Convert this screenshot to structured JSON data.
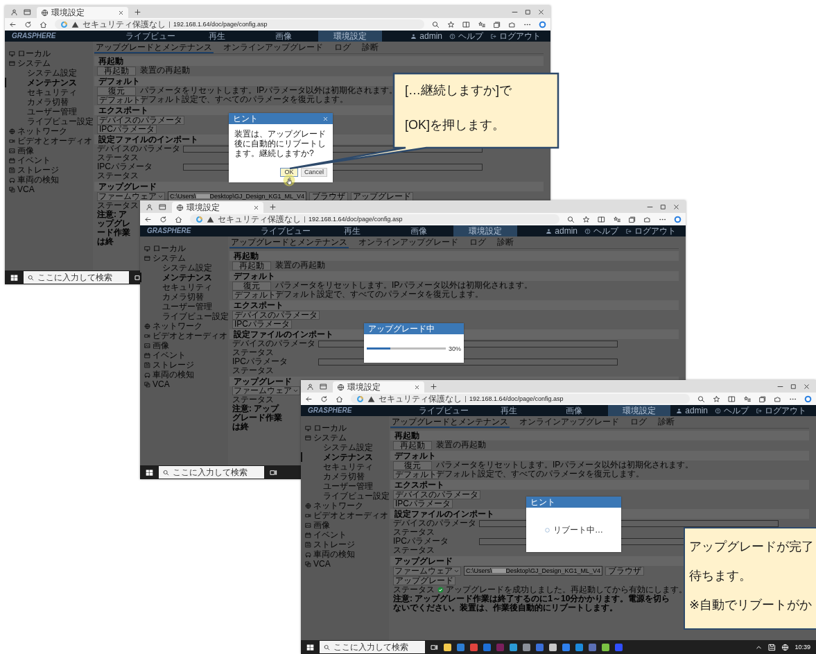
{
  "screenshots": [
    {
      "browser": {
        "tab_title": "環境設定",
        "security": "セキュリティ保護なし",
        "url": "192.168.1.64/doc/page/config.asp"
      },
      "app": {
        "logo": "GRASPHERE",
        "nav": [
          {
            "label": "ライブビュー",
            "selected": false
          },
          {
            "label": "再生",
            "selected": false
          },
          {
            "label": "画像",
            "selected": false
          },
          {
            "label": "環境設定",
            "selected": true
          }
        ],
        "user": "admin",
        "help": "ヘルプ",
        "logout": "ログアウト",
        "sidebar": [
          {
            "label": "ローカル",
            "selected": false
          },
          {
            "label": "システム",
            "selected": false,
            "children": [
              {
                "label": "システム設定",
                "selected": false
              },
              {
                "label": "メンテナンス",
                "selected": true
              },
              {
                "label": "セキュリティ",
                "selected": false
              },
              {
                "label": "カメラ切替",
                "selected": false
              },
              {
                "label": "ユーザー管理",
                "selected": false
              },
              {
                "label": "ライブビュー設定",
                "selected": false
              }
            ]
          },
          {
            "label": "ネットワーク",
            "selected": false
          },
          {
            "label": "ビデオとオーディオ",
            "selected": false
          },
          {
            "label": "画像",
            "selected": false
          },
          {
            "label": "イベント",
            "selected": false
          },
          {
            "label": "ストレージ",
            "selected": false
          },
          {
            "label": "車両の検知",
            "selected": false
          },
          {
            "label": "VCA",
            "selected": false
          }
        ],
        "subtabs": [
          {
            "label": "アップグレードとメンテナンス",
            "selected": true
          },
          {
            "label": "オンラインアップグレード",
            "selected": false
          },
          {
            "label": "ログ",
            "selected": false
          },
          {
            "label": "診断",
            "selected": false
          }
        ],
        "sections": [
          {
            "title": "再起動",
            "rows": [
              {
                "kind": "action",
                "button": "再起動",
                "text": "装置の再起動"
              }
            ]
          },
          {
            "title": "デフォルト",
            "rows": [
              {
                "kind": "action",
                "button": "復元",
                "text": "パラメータをリセットします。IPパラメータ以外は初期化されます。"
              },
              {
                "kind": "action",
                "button": "デフォルト",
                "text": "デフォルト設定で、すべてのパラメータを復元します。"
              }
            ]
          },
          {
            "title": "エクスポート",
            "rows": [
              {
                "kind": "action",
                "button": "デバイスのパラメータ"
              },
              {
                "kind": "action",
                "button": "IPCパラメータ"
              }
            ]
          },
          {
            "title": "設定ファイルのインポート",
            "rows": [
              {
                "kind": "file",
                "label": "デバイスのパラメータ"
              },
              {
                "kind": "status",
                "label": "ステータス"
              },
              {
                "kind": "file",
                "label": "IPCパラメータ"
              },
              {
                "kind": "status",
                "label": "ステータス"
              }
            ]
          },
          {
            "title": "アップグレード",
            "rows": [
              {
                "kind": "upgrade",
                "select": "ファームウェア",
                "path_start": "C:\\Users\\",
                "path_end": "Desktop\\GJ_Design_KG1_ML_V4",
                "buttons": [
                  "ブラウザ",
                  "アップグレード"
                ]
              },
              {
                "kind": "status",
                "label": "ステータス"
              },
              {
                "kind": "note",
                "text": "注意: アップグレード作業は終"
              }
            ]
          }
        ]
      },
      "dialog": {
        "kind": "confirm",
        "title": "ヒント",
        "message": "装置は、アップグレード後に自動的にリブートします。継続しますか?",
        "buttons": [
          "OK",
          "Cancel"
        ]
      },
      "taskbar": {
        "search": "ここに入力して検索"
      }
    },
    {
      "browser": {
        "tab_title": "環境設定",
        "security": "セキュリティ保護なし",
        "url": "192.168.1.64/doc/page/config.asp"
      },
      "app": {
        "logo": "GRASPHERE",
        "nav": [
          {
            "label": "ライブビュー",
            "selected": false
          },
          {
            "label": "再生",
            "selected": false
          },
          {
            "label": "画像",
            "selected": false
          },
          {
            "label": "環境設定",
            "selected": true
          }
        ],
        "user": "admin",
        "help": "ヘルプ",
        "logout": "ログアウト",
        "sidebar": [
          {
            "label": "ローカル",
            "selected": false
          },
          {
            "label": "システム",
            "selected": false,
            "children": [
              {
                "label": "システム設定",
                "selected": false
              },
              {
                "label": "メンテナンス",
                "selected": true
              },
              {
                "label": "セキュリティ",
                "selected": false
              },
              {
                "label": "カメラ切替",
                "selected": false
              },
              {
                "label": "ユーザー管理",
                "selected": false
              },
              {
                "label": "ライブビュー設定",
                "selected": false
              }
            ]
          },
          {
            "label": "ネットワーク",
            "selected": false
          },
          {
            "label": "ビデオとオーディオ",
            "selected": false
          },
          {
            "label": "画像",
            "selected": false
          },
          {
            "label": "イベント",
            "selected": false
          },
          {
            "label": "ストレージ",
            "selected": false
          },
          {
            "label": "車両の検知",
            "selected": false
          },
          {
            "label": "VCA",
            "selected": false
          }
        ],
        "subtabs": [
          {
            "label": "アップグレードとメンテナンス",
            "selected": true
          },
          {
            "label": "オンラインアップグレード",
            "selected": false
          },
          {
            "label": "ログ",
            "selected": false
          },
          {
            "label": "診断",
            "selected": false
          }
        ],
        "sections": [
          {
            "title": "再起動",
            "rows": [
              {
                "kind": "action",
                "button": "再起動",
                "text": "装置の再起動"
              }
            ]
          },
          {
            "title": "デフォルト",
            "rows": [
              {
                "kind": "action",
                "button": "復元",
                "text": "パラメータをリセットします。IPパラメータ以外は初期化されます。"
              },
              {
                "kind": "action",
                "button": "デフォルト",
                "text": "デフォルト設定で、すべてのパラメータを復元します。"
              }
            ]
          },
          {
            "title": "エクスポート",
            "rows": [
              {
                "kind": "action",
                "button": "デバイスのパラメータ"
              },
              {
                "kind": "action",
                "button": "IPCパラメータ"
              }
            ]
          },
          {
            "title": "設定ファイルのインポート",
            "rows": [
              {
                "kind": "file",
                "label": "デバイスのパラメータ"
              },
              {
                "kind": "status",
                "label": "ステータス"
              },
              {
                "kind": "file",
                "label": "IPCパラメータ"
              },
              {
                "kind": "status",
                "label": "ステータス"
              }
            ]
          },
          {
            "title": "アップグレード",
            "rows": [
              {
                "kind": "upgrade",
                "select": "ファームウェア"
              },
              {
                "kind": "status",
                "label": "ステータス"
              },
              {
                "kind": "note",
                "text": "注意: アップグレード作業は終"
              }
            ]
          }
        ]
      },
      "dialog": {
        "kind": "progress",
        "title": "アップグレード中",
        "level": 0.3,
        "reading": "30%"
      },
      "taskbar": {
        "search": "ここに入力して検索"
      }
    },
    {
      "browser": {
        "tab_title": "環境設定",
        "security": "セキュリティ保護なし",
        "url": "192.168.1.64/doc/page/config.asp"
      },
      "app": {
        "logo": "GRASPHERE",
        "nav": [
          {
            "label": "ライブビュー",
            "selected": false
          },
          {
            "label": "再生",
            "selected": false
          },
          {
            "label": "画像",
            "selected": false
          },
          {
            "label": "環境設定",
            "selected": true
          }
        ],
        "user": "admin",
        "help": "ヘルプ",
        "logout": "ログアウト",
        "sidebar": [
          {
            "label": "ローカル",
            "selected": false
          },
          {
            "label": "システム",
            "selected": false,
            "children": [
              {
                "label": "システム設定",
                "selected": false
              },
              {
                "label": "メンテナンス",
                "selected": true
              },
              {
                "label": "セキュリティ",
                "selected": false
              },
              {
                "label": "カメラ切替",
                "selected": false
              },
              {
                "label": "ユーザー管理",
                "selected": false
              },
              {
                "label": "ライブビュー設定",
                "selected": false
              }
            ]
          },
          {
            "label": "ネットワーク",
            "selected": false
          },
          {
            "label": "ビデオとオーディオ",
            "selected": false
          },
          {
            "label": "画像",
            "selected": false
          },
          {
            "label": "イベント",
            "selected": false
          },
          {
            "label": "ストレージ",
            "selected": false
          },
          {
            "label": "車両の検知",
            "selected": false
          },
          {
            "label": "VCA",
            "selected": false
          }
        ],
        "subtabs": [
          {
            "label": "アップグレードとメンテナンス",
            "selected": true
          },
          {
            "label": "オンラインアップグレード",
            "selected": false
          },
          {
            "label": "ログ",
            "selected": false
          },
          {
            "label": "診断",
            "selected": false
          }
        ],
        "sections": [
          {
            "title": "再起動",
            "rows": [
              {
                "kind": "action",
                "button": "再起動",
                "text": "装置の再起動"
              }
            ]
          },
          {
            "title": "デフォルト",
            "rows": [
              {
                "kind": "action",
                "button": "復元",
                "text": "パラメータをリセットします。IPパラメータ以外は初期化されます。"
              },
              {
                "kind": "action",
                "button": "デフォルト",
                "text": "デフォルト設定で、すべてのパラメータを復元します。"
              }
            ]
          },
          {
            "title": "エクスポート",
            "rows": [
              {
                "kind": "action",
                "button": "デバイスのパラメータ"
              },
              {
                "kind": "action",
                "button": "IPCパラメータ"
              }
            ]
          },
          {
            "title": "設定ファイルのインポート",
            "rows": [
              {
                "kind": "file",
                "label": "デバイスのパラメータ"
              },
              {
                "kind": "status",
                "label": "ステータス"
              },
              {
                "kind": "file",
                "label": "IPCパラメータ"
              },
              {
                "kind": "status",
                "label": "ステータス"
              }
            ]
          },
          {
            "title": "アップグレード",
            "rows": [
              {
                "kind": "upgrade",
                "select": "ファームウェア",
                "path_start": "C:\\Users\\",
                "path_end": "Desktop\\GJ_Design_KG1_ML_V4",
                "buttons": [
                  "ブラウザ",
                  "アップグレード"
                ]
              },
              {
                "kind": "status",
                "label": "ステータス",
                "message": "アップグレードを成功しました。再起動してから有効にします。"
              },
              {
                "kind": "note",
                "text": "注意: アップグレード作業は終了するのに1～10分かかります。電源を切らないでください。装置は、作業後自動的にリブートします。"
              }
            ]
          }
        ]
      },
      "dialog": {
        "kind": "busy",
        "title": "ヒント",
        "message": "リブート中…"
      },
      "taskbar": {
        "search": "ここに入力して検索",
        "time": "10:39"
      }
    }
  ],
  "callouts": [
    {
      "lines": [
        "[…継続しますか]で",
        "[OK]を押します。"
      ]
    },
    {
      "lines": [
        "アップグレードが完了",
        "待ちます。",
        "※自動でリブートがか"
      ]
    }
  ]
}
